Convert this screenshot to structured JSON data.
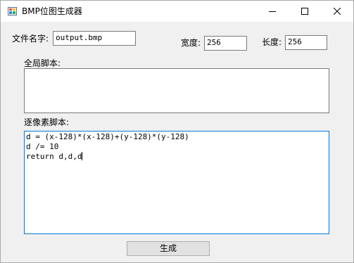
{
  "window": {
    "title": "BMP位图生成器"
  },
  "file": {
    "label": "文件名字:",
    "value": "output.bmp"
  },
  "width": {
    "label": "宽度:",
    "value": "256"
  },
  "height": {
    "label": "长度:",
    "value": "256"
  },
  "global_script": {
    "label": "全局脚本:",
    "value": ""
  },
  "pixel_script": {
    "label": "逐像素脚本:",
    "lines": [
      "d = (x-128)*(x-128)+(y-128)*(y-128)",
      "d /= 10",
      "return d,d,d"
    ]
  },
  "actions": {
    "generate_label": "生成"
  },
  "icons": {
    "app": "bitmap-app-icon",
    "minimize": "minimize-icon",
    "maximize": "maximize-icon",
    "close": "close-icon"
  }
}
